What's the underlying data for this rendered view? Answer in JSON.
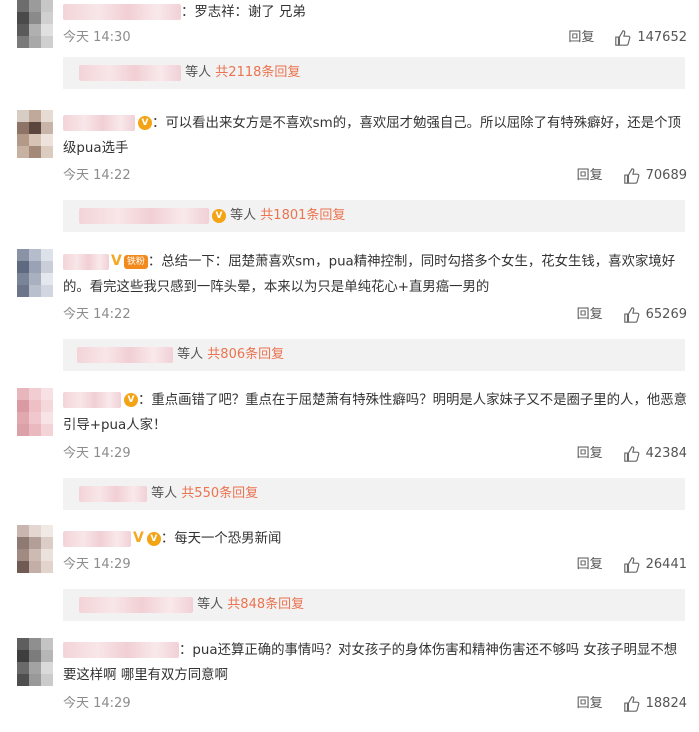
{
  "comments": [
    {
      "text": "：罗志祥：谢了 兄弟",
      "time": "今天 14:30",
      "reply_label": "回复",
      "likes": "147652",
      "replies_suffix": "等人",
      "replies_count": "共2118条回复",
      "avatar_colors": [
        "#6d6d6d",
        "#9b9b9b",
        "#c7c7c7",
        "#4a4a4a",
        "#8a8a8a",
        "#d0d0d0",
        "#5a5a5a",
        "#b0b0b0",
        "#e0e0e0",
        "#7a7a7a",
        "#a8a8a8",
        "#cfcfcf"
      ]
    },
    {
      "text": "：可以看出来女方是不喜欢sm的，喜欢屈才勉强自己。所以屈除了有特殊癖好，还是个顶级pua选手",
      "time": "今天 14:22",
      "reply_label": "回复",
      "likes": "70689",
      "replies_suffix": "等人",
      "replies_count": "共1801条回复",
      "avatar_colors": [
        "#d8cdc4",
        "#bfa99a",
        "#e6dcd4",
        "#8e7466",
        "#5a463c",
        "#c8b4a8",
        "#b29988",
        "#d6c3b6",
        "#ede3dc",
        "#c7b1a3",
        "#a48978",
        "#dcccbf"
      ]
    },
    {
      "text": "：总结一下：屈楚萧喜欢sm，pua精神控制，同时勾搭多个女生，花女生钱，喜欢家境好的。看完这些我只感到一阵头晕，本来以为只是单纯花心+直男癌一男的",
      "time": "今天 14:22",
      "reply_label": "回复",
      "likes": "65269",
      "replies_suffix": "等人",
      "replies_count": "共806条回复",
      "fan_badge": "铁粉",
      "avatar_colors": [
        "#8a93a6",
        "#b5bccb",
        "#dde1ea",
        "#5f6a80",
        "#9aa3b5",
        "#c9ced9",
        "#7a8499",
        "#a9b0c0",
        "#e4e7ee",
        "#6b7489",
        "#b9bfcc",
        "#d2d6e0"
      ]
    },
    {
      "text": "：重点画错了吧？重点在于屈楚萧有特殊性癖吗？明明是人家妹子又不是圈子里的人，他恶意引导+pua人家！",
      "time": "今天 14:29",
      "reply_label": "回复",
      "likes": "42384",
      "replies_suffix": "等人",
      "replies_count": "共550条回复",
      "avatar_colors": [
        "#e8b7bd",
        "#f1cdd2",
        "#f7e1e4",
        "#d99aa3",
        "#eec0c6",
        "#f4d8dc",
        "#e2a8b0",
        "#f0c7cd",
        "#f8e3e6",
        "#dca0a9",
        "#eab9c0",
        "#f3d3d8"
      ]
    },
    {
      "text": "：每天一个恐男新闻",
      "time": "今天 14:29",
      "reply_label": "回复",
      "likes": "26441",
      "replies_suffix": "等人",
      "replies_count": "共848条回复",
      "avatar_colors": [
        "#c9b6ae",
        "#e4d6d0",
        "#f1e9e5",
        "#8e7a72",
        "#b39f97",
        "#dccdc6",
        "#a08a82",
        "#cdbab2",
        "#ece2dd",
        "#6f5b54",
        "#c3afa7",
        "#e2d3cc"
      ]
    },
    {
      "text": "：pua还算正确的事情吗？对女孩子的身体伤害和精神伤害还不够吗  女孩子明显不想要这样啊  哪里有双方同意啊",
      "time": "今天 14:29",
      "reply_label": "回复",
      "likes": "18824",
      "avatar_colors": [
        "#5e5e5e",
        "#8f8f8f",
        "#c4c4c4",
        "#3e3e3e",
        "#7c7c7c",
        "#b6b6b6",
        "#6a6a6a",
        "#a3a3a3",
        "#dadada",
        "#4f4f4f",
        "#999999",
        "#cbcbcb"
      ]
    }
  ]
}
